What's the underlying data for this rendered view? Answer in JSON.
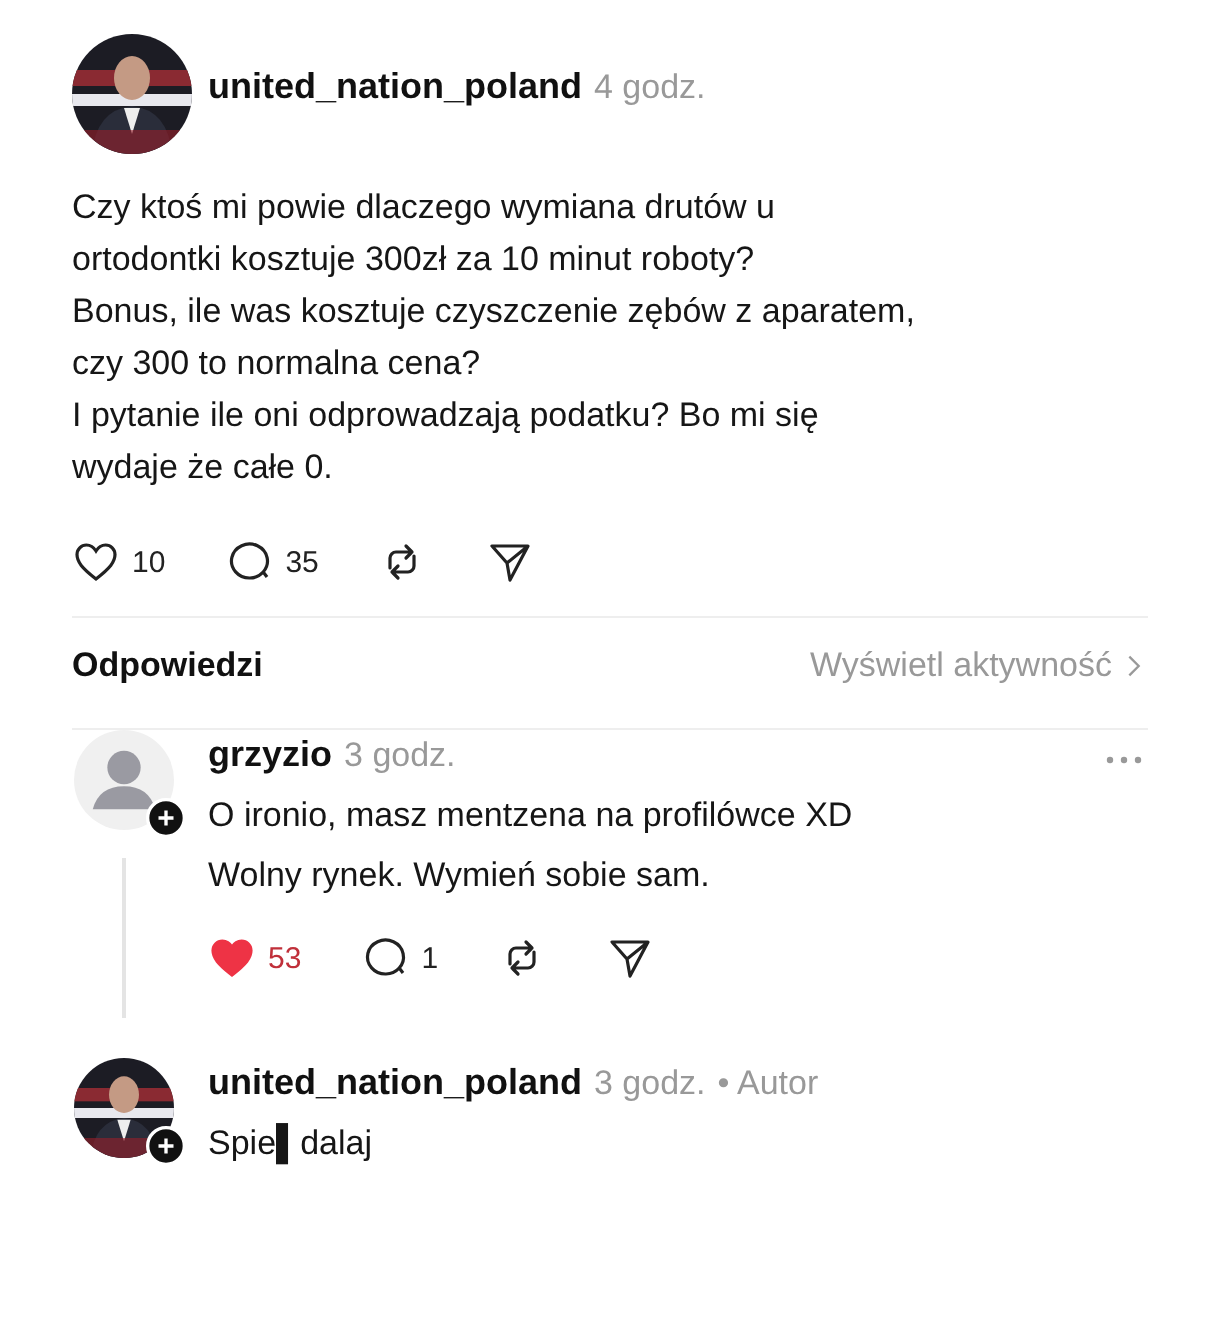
{
  "post": {
    "author": "united_nation_poland",
    "time": "4 godz.",
    "text": [
      "Czy ktoś mi powie dlaczego wymiana drutów u",
      "ortodontki kosztuje 300zł za 10 minut roboty?",
      "Bonus, ile was kosztuje czyszczenie zębów z aparatem,",
      "czy 300 to normalna cena?",
      "I pytanie ile oni odprowadzają podatku? Bo mi się",
      "wydaje że całe 0."
    ],
    "actions": [
      {
        "kind": "like",
        "count": "10",
        "liked": false
      },
      {
        "kind": "comment",
        "count": "35"
      },
      {
        "kind": "repost"
      },
      {
        "kind": "share"
      }
    ]
  },
  "replies_header": {
    "title": "Odpowiedzi",
    "link": "Wyświetl aktywność"
  },
  "replies": [
    {
      "author": "grzyzio",
      "time": "3 godz.",
      "avatar": {
        "kind": "placeholder"
      },
      "more_menu": true,
      "text": [
        "O ironio, masz mentzena na profilówce XD",
        "Wolny rynek. Wymień sobie sam."
      ],
      "actions": [
        {
          "kind": "like",
          "count": "53",
          "liked": true
        },
        {
          "kind": "comment",
          "count": "1"
        },
        {
          "kind": "repost"
        },
        {
          "kind": "share"
        }
      ]
    },
    {
      "author": "united_nation_poland",
      "time": "3 godz.",
      "badge": "• Autor",
      "avatar": {
        "kind": "picture"
      },
      "more_menu": false,
      "text": [
        "Spie▌dalaj"
      ]
    }
  ]
}
